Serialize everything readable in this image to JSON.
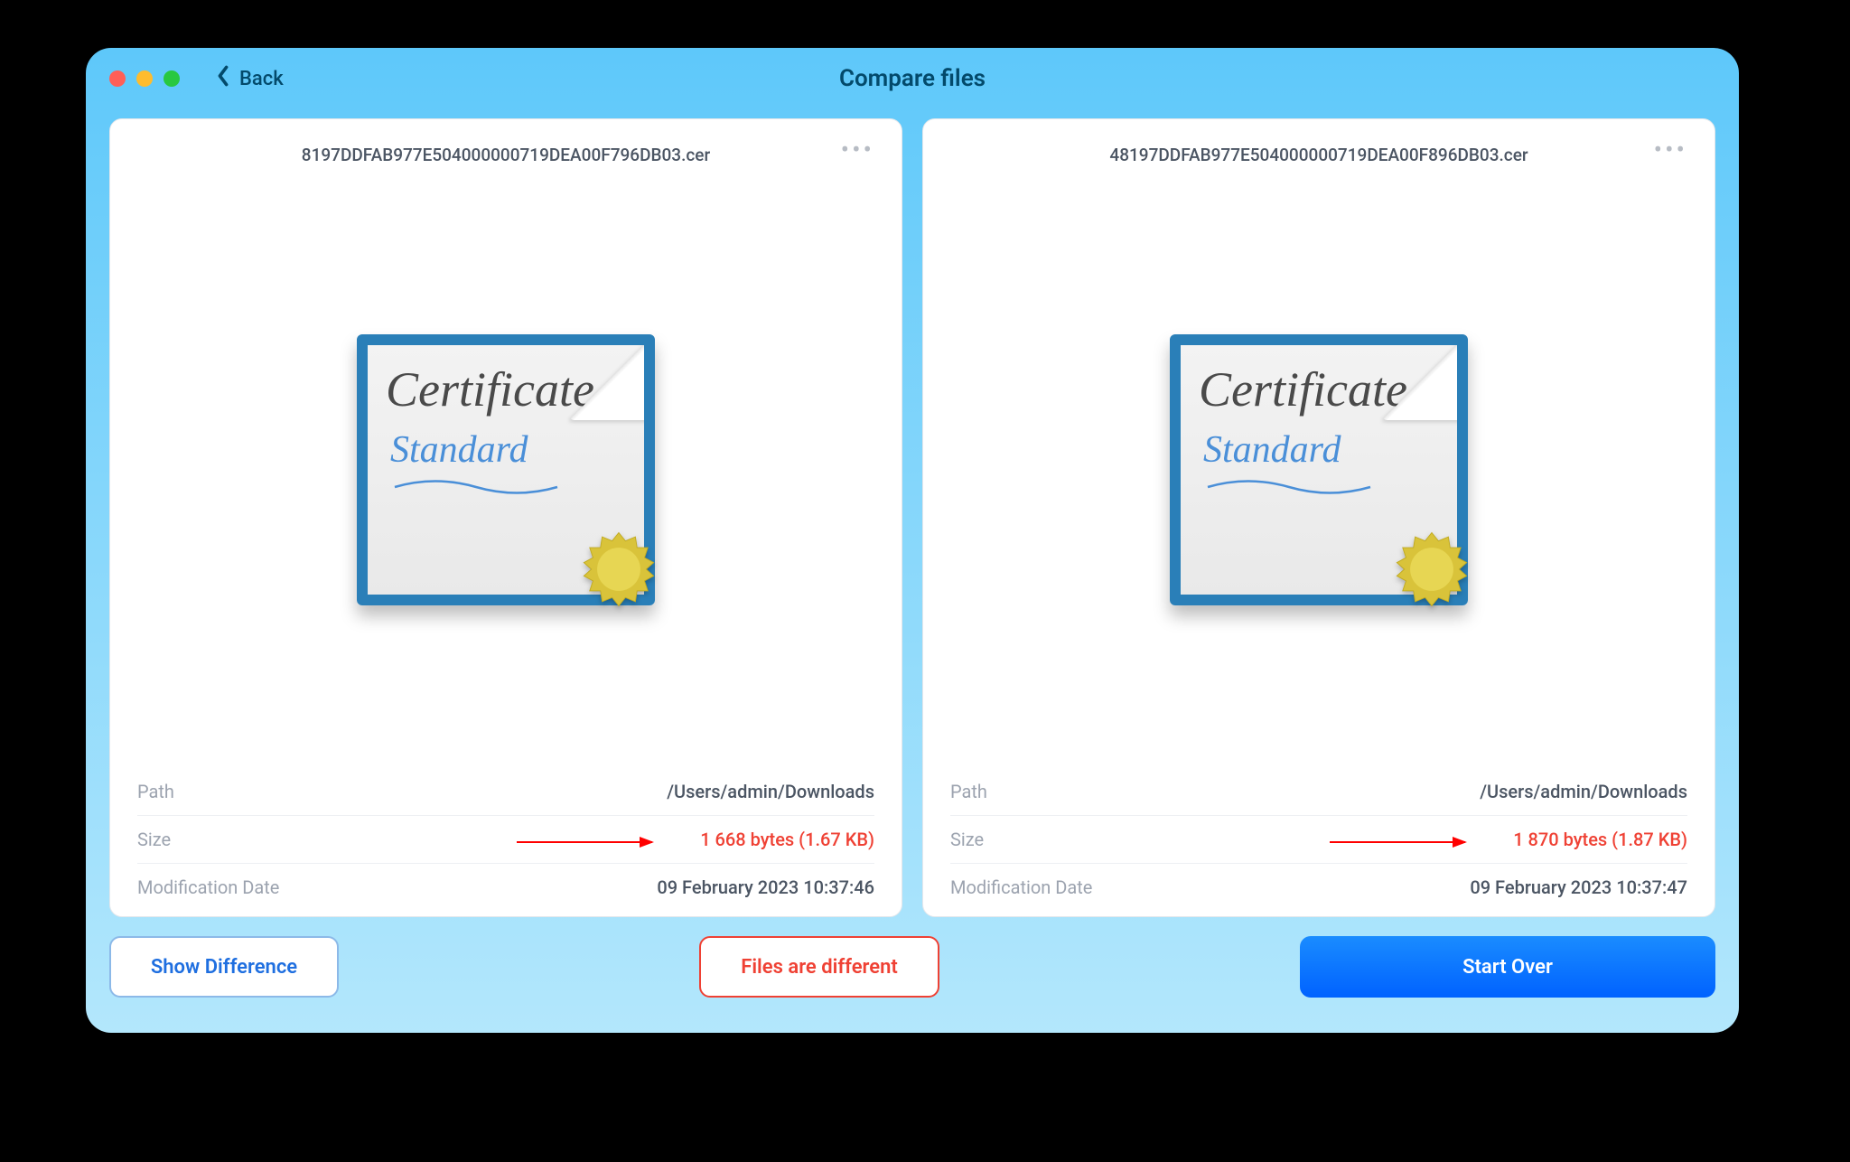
{
  "header": {
    "back_label": "Back",
    "title": "Compare files"
  },
  "files": [
    {
      "name": "8197DDFAB977E504000000719DEA00F796DB03.cer",
      "icon_title": "Certificate",
      "icon_subtitle": "Standard",
      "meta": {
        "path_label": "Path",
        "path_value": "/Users/admin/Downloads",
        "size_label": "Size",
        "size_value": "1 668 bytes (1.67 KB)",
        "mod_label": "Modification Date",
        "mod_value": "09 February 2023 10:37:46"
      }
    },
    {
      "name": "48197DDFAB977E504000000719DEA00F896DB03.cer",
      "icon_title": "Certificate",
      "icon_subtitle": "Standard",
      "meta": {
        "path_label": "Path",
        "path_value": "/Users/admin/Downloads",
        "size_label": "Size",
        "size_value": "1 870 bytes (1.87 KB)",
        "mod_label": "Modification Date",
        "mod_value": "09 February 2023 10:37:47"
      }
    }
  ],
  "footer": {
    "show_diff": "Show Difference",
    "status": "Files are different",
    "start_over": "Start Over"
  },
  "colors": {
    "accent": "#0a7bff",
    "diff": "#ef4134"
  }
}
